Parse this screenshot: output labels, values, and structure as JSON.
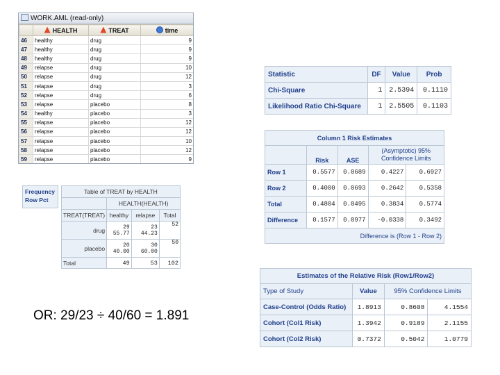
{
  "viewer": {
    "title": "WORK.AML (read-only)",
    "columns": [
      "HEALTH",
      "TREAT",
      "time"
    ],
    "rows": [
      {
        "n": "46",
        "health": "healthy",
        "treat": "drug",
        "time": "9"
      },
      {
        "n": "47",
        "health": "healthy",
        "treat": "drug",
        "time": "9"
      },
      {
        "n": "48",
        "health": "healthy",
        "treat": "drug",
        "time": "9"
      },
      {
        "n": "49",
        "health": "relapse",
        "treat": "drug",
        "time": "10"
      },
      {
        "n": "50",
        "health": "relapse",
        "treat": "drug",
        "time": "12"
      },
      {
        "n": "51",
        "health": "relapse",
        "treat": "drug",
        "time": "3"
      },
      {
        "n": "52",
        "health": "relapse",
        "treat": "drug",
        "time": "6"
      },
      {
        "n": "53",
        "health": "relapse",
        "treat": "placebo",
        "time": "8"
      },
      {
        "n": "54",
        "health": "healthy",
        "treat": "placebo",
        "time": "3"
      },
      {
        "n": "55",
        "health": "relapse",
        "treat": "placebo",
        "time": "12"
      },
      {
        "n": "56",
        "health": "relapse",
        "treat": "placebo",
        "time": "12"
      },
      {
        "n": "57",
        "health": "relapse",
        "treat": "placebo",
        "time": "10"
      },
      {
        "n": "58",
        "health": "relapse",
        "treat": "placebo",
        "time": "12"
      },
      {
        "n": "59",
        "health": "relapse",
        "treat": "placebo",
        "time": "9"
      }
    ]
  },
  "chisq": {
    "headers": [
      "Statistic",
      "DF",
      "Value",
      "Prob"
    ],
    "rows": [
      {
        "stat": "Chi-Square",
        "df": "1",
        "value": "2.5394",
        "prob": "0.1110"
      },
      {
        "stat": "Likelihood Ratio Chi-Square",
        "df": "1",
        "value": "2.5505",
        "prob": "0.1103"
      }
    ]
  },
  "risk": {
    "title": "Column 1 Risk Estimates",
    "ci_header": "(Asymptotic) 95% Confidence Limits",
    "headers": [
      "Risk",
      "ASE"
    ],
    "rows": [
      {
        "label": "Row 1",
        "risk": "0.5577",
        "ase": "0.0689",
        "lo": "0.4227",
        "hi": "0.6927"
      },
      {
        "label": "Row 2",
        "risk": "0.4000",
        "ase": "0.0693",
        "lo": "0.2642",
        "hi": "0.5358"
      },
      {
        "label": "Total",
        "risk": "0.4804",
        "ase": "0.0495",
        "lo": "0.3834",
        "hi": "0.5774"
      },
      {
        "label": "Difference",
        "risk": "0.1577",
        "ase": "0.0977",
        "lo": "-0.0338",
        "hi": "0.3492"
      }
    ],
    "footer": "Difference is (Row 1 - Row 2)"
  },
  "rr": {
    "title": "Estimates of the Relative Risk (Row1/Row2)",
    "headers": [
      "Type of Study",
      "Value",
      "95% Confidence Limits"
    ],
    "rows": [
      {
        "type": "Case-Control (Odds Ratio)",
        "value": "1.8913",
        "lo": "0.8608",
        "hi": "4.1554"
      },
      {
        "type": "Cohort (Col1 Risk)",
        "value": "1.3942",
        "lo": "0.9189",
        "hi": "2.1155"
      },
      {
        "type": "Cohort (Col2 Risk)",
        "value": "0.7372",
        "lo": "0.5042",
        "hi": "1.0779"
      }
    ]
  },
  "freq": {
    "key": [
      "Frequency",
      "Row Pct"
    ],
    "title": "Table of TREAT by HEALTH",
    "col_var": "HEALTH(HEALTH)",
    "row_var": "TREAT(TREAT)",
    "col_headers": [
      "healthy",
      "relapse",
      "Total"
    ],
    "rows": [
      {
        "label": "drug",
        "c1": "29",
        "c1p": "55.77",
        "c2": "23",
        "c2p": "44.23",
        "total": "52"
      },
      {
        "label": "placebo",
        "c1": "20",
        "c1p": "40.00",
        "c2": "30",
        "c2p": "60.00",
        "total": "50"
      }
    ],
    "total_label": "Total",
    "totals": [
      "49",
      "53",
      "102"
    ]
  },
  "formula": "OR:  29/23 ÷ 40/60 = 1.891"
}
